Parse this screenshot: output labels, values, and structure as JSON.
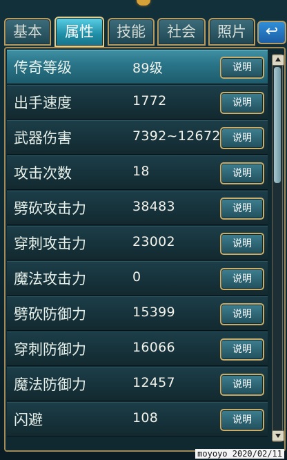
{
  "tabs": [
    {
      "label": "基本",
      "active": false
    },
    {
      "label": "属性",
      "active": true
    },
    {
      "label": "技能",
      "active": false
    },
    {
      "label": "社会",
      "active": false
    },
    {
      "label": "照片",
      "active": false
    }
  ],
  "back_icon": "return-arrow-icon",
  "attributes": [
    {
      "name": "传奇等级",
      "value": "89级",
      "button": "说明"
    },
    {
      "name": "出手速度",
      "value": "1772",
      "button": "说明"
    },
    {
      "name": "武器伤害",
      "value": "7392~12672",
      "button": "说明"
    },
    {
      "name": "攻击次数",
      "value": "18",
      "button": "说明"
    },
    {
      "name": "劈砍攻击力",
      "value": "38483",
      "button": "说明"
    },
    {
      "name": "穿刺攻击力",
      "value": "23002",
      "button": "说明"
    },
    {
      "name": "魔法攻击力",
      "value": "0",
      "button": "说明"
    },
    {
      "name": "劈砍防御力",
      "value": "15399",
      "button": "说明"
    },
    {
      "name": "穿刺防御力",
      "value": "16066",
      "button": "说明"
    },
    {
      "name": "魔法防御力",
      "value": "12457",
      "button": "说明"
    },
    {
      "name": "闪避",
      "value": "108",
      "button": "说明"
    }
  ],
  "watermark": "moyoyo 2020/02/11",
  "colors": {
    "active_tab": "#2fa9c3",
    "button_border": "#c9ad6a",
    "panel_border": "#a38b57"
  }
}
